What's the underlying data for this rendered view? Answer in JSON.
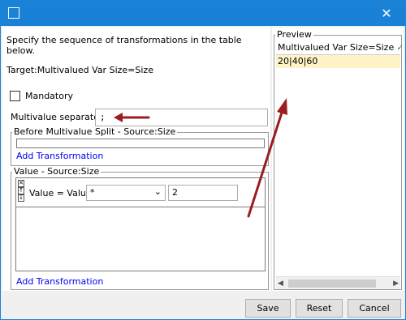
{
  "window": {
    "title": "",
    "close_glyph": "✕"
  },
  "instruction": "Specify the sequence of transformations in the table below.",
  "target": "Target:Multivalued Var Size=Size",
  "mandatory": {
    "label": "Mandatory",
    "checked": false
  },
  "separator": {
    "label": "Multivalue separator",
    "value": ";"
  },
  "before_split": {
    "legend": "Before Multivalue Split - Source:Size",
    "add_link": "Add Transformation"
  },
  "value_group": {
    "legend": "Value - Source:Size",
    "rows": [
      {
        "label": "Value = Value",
        "operator": "*",
        "operand": "2"
      }
    ],
    "row_controls": {
      "remove": "✕",
      "up": "↑",
      "down": "↓"
    },
    "add_link": "Add Transformation"
  },
  "preview": {
    "legend": "Preview",
    "header": "Multivalued Var Size=Size",
    "header_check": "✓",
    "value": "20|40|60"
  },
  "buttons": {
    "save": "Save",
    "reset": "Reset",
    "cancel": "Cancel"
  },
  "icons": {
    "window": "app-icon",
    "close": "close-icon",
    "check": "check-icon",
    "chevron": "chevron-down-icon"
  },
  "colors": {
    "titlebar": "#1a82d6",
    "annotation_arrow": "#9b1d1d",
    "preview_highlight": "#fdf3c4",
    "link": "#0000ee"
  }
}
